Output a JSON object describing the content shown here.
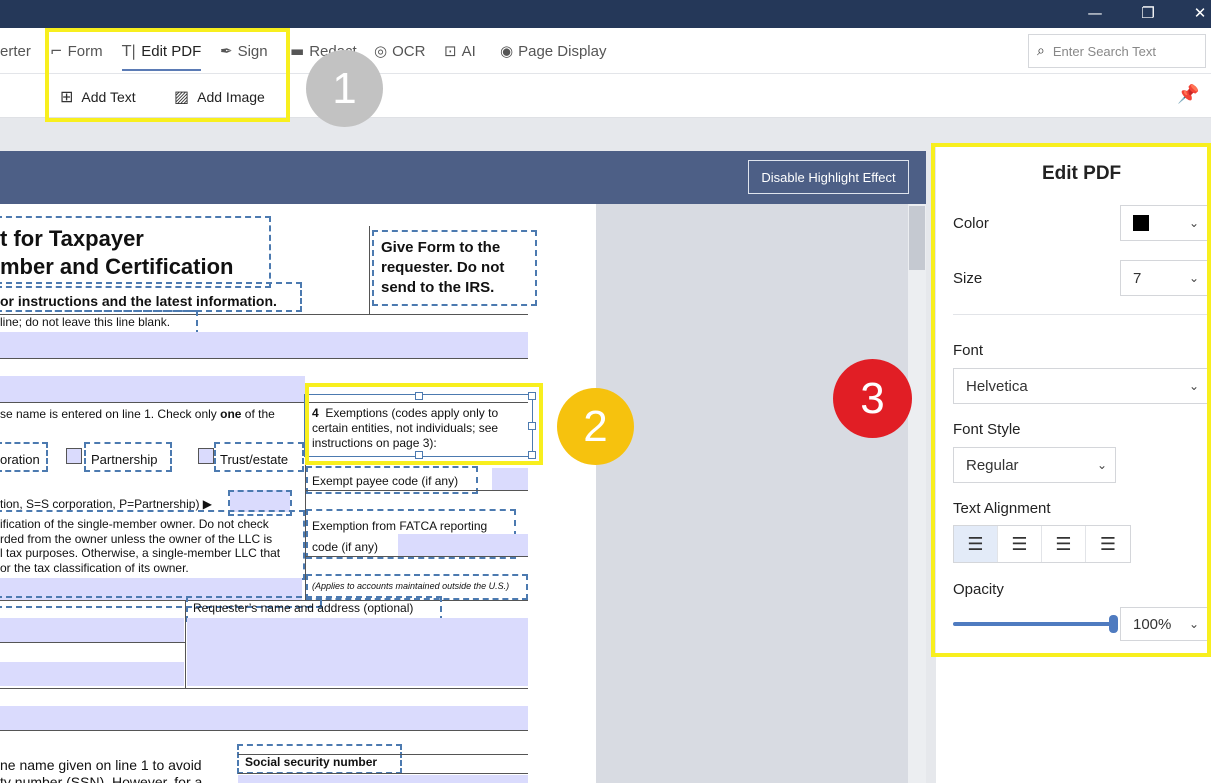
{
  "window": {
    "controls": {
      "minimize": "—",
      "restore": "❐",
      "close": "✕"
    }
  },
  "ribbon": {
    "tabs": [
      {
        "label": "erter",
        "icon": ""
      },
      {
        "label": "Form",
        "icon": "⌐"
      },
      {
        "label": "Edit PDF",
        "icon": "T|"
      },
      {
        "label": "Sign",
        "icon": "✒"
      },
      {
        "label": "Redact",
        "icon": "▬"
      },
      {
        "label": "OCR",
        "icon": "◎"
      },
      {
        "label": "AI",
        "icon": "⊡"
      },
      {
        "label": "Page Display",
        "icon": "◉"
      }
    ],
    "search": {
      "placeholder": "Enter Search Text",
      "icon": "⌕"
    },
    "tools": [
      {
        "label": "Add Text",
        "icon": "⊞"
      },
      {
        "label": "Add Image",
        "icon": "▨"
      }
    ],
    "pin_icon": "📌"
  },
  "annotations": {
    "badge1": "1",
    "badge2": "2",
    "badge3": "3"
  },
  "document": {
    "disable_highlight": "Disable Highlight Effect",
    "title_line1": "t for Taxpayer",
    "title_line2": "mber and Certification",
    "instructions": "or instructions and the latest information.",
    "give_form_l1": "Give Form to the",
    "give_form_l2": "requester. Do not",
    "give_form_l3": "send to the IRS.",
    "line1": "line; do not leave this line blank.",
    "line3_text": "se name is entered on line 1. Check only ",
    "line3_bold": "one",
    "line3_end": " of the",
    "exemptions_num": "4",
    "exemptions_l1": "Exemptions (codes apply only to",
    "exemptions_l2": "certain entities, not individuals; see",
    "exemptions_l3": "instructions on page 3):",
    "oration": "oration",
    "partnership": "Partnership",
    "trust": "Trust/estate",
    "exempt_payee": "Exempt payee code (if any)",
    "tax_class": "tion, S=S corporation, P=Partnership) ▶",
    "fatca_l1": "Exemption from FATCA reporting",
    "fatca_l2": "code (if any)",
    "para1": "ification of the single-member owner.  Do not check",
    "para2": "rded from the owner unless the owner of the LLC is",
    "para3": "l tax purposes. Otherwise, a single-member LLC that",
    "para4": "or the tax classification of its owner.",
    "applies": "(Applies to accounts maintained outside the U.S.)",
    "requester": "Requester’s name and address (optional)",
    "ssn": "Social security number",
    "bottom1": "ne name given on line 1 to avoid",
    "bottom2": "ty number (SSN). However, for a"
  },
  "panel": {
    "title": "Edit PDF",
    "color_label": "Color",
    "color_value": "#000000",
    "size_label": "Size",
    "size_value": "7",
    "font_label": "Font",
    "font_value": "Helvetica",
    "style_label": "Font Style",
    "style_value": "Regular",
    "align_label": "Text Alignment",
    "opacity_label": "Opacity",
    "opacity_value": "100%",
    "chevron": "⌄"
  }
}
